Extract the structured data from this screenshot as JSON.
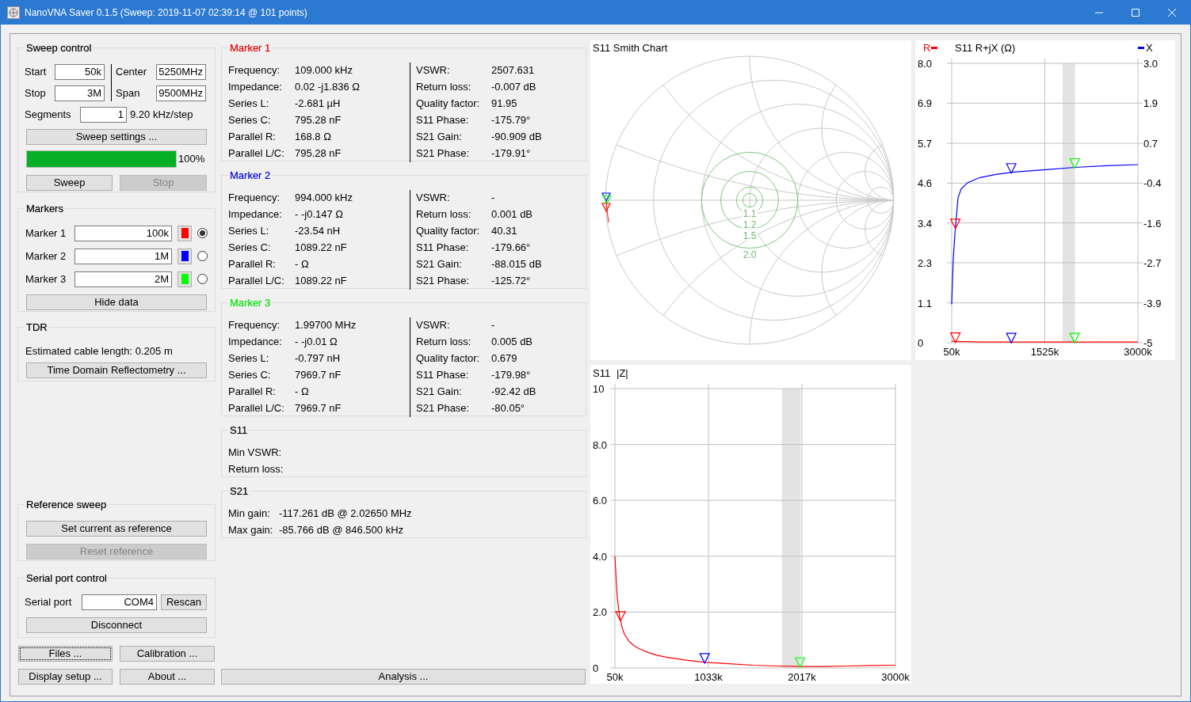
{
  "window": {
    "title": "NanoVNA Saver 0.1.5 (Sweep: 2019-11-07 02:39:14 @ 101 points)"
  },
  "sweep_control": {
    "title": "Sweep control",
    "start": {
      "label": "Start",
      "value": "50k"
    },
    "stop": {
      "label": "Stop",
      "value": "3M"
    },
    "center": {
      "label": "Center",
      "value": "5250MHz"
    },
    "span": {
      "label": "Span",
      "value": "9500MHz"
    },
    "segments": {
      "label": "Segments",
      "value": "1"
    },
    "step": "9.20 kHz/step",
    "settings_button": "Sweep settings ...",
    "progress": {
      "level": 1.0,
      "text": "100%"
    },
    "buttons": [
      {
        "label": "Sweep",
        "disabled": false
      },
      {
        "label": "Stop",
        "disabled": true
      }
    ]
  },
  "markers": {
    "title": "Markers",
    "items": [
      {
        "label": "Marker 1",
        "value": "100k",
        "color": "#ff0000",
        "selected": true
      },
      {
        "label": "Marker 2",
        "value": "1M",
        "color": "#0000ff",
        "selected": false
      },
      {
        "label": "Marker 3",
        "value": "2M",
        "color": "#00ff00",
        "selected": false
      }
    ],
    "hide_button": "Hide data"
  },
  "tdr": {
    "title": "TDR",
    "text": "Estimated cable length: 0.205 m",
    "button": "Time Domain Reflectometry ..."
  },
  "reference_sweep": {
    "title": "Reference sweep",
    "buttons": [
      {
        "label": "Set current as reference",
        "disabled": false
      },
      {
        "label": "Reset reference",
        "disabled": true
      }
    ]
  },
  "serial_port": {
    "title": "Serial port control",
    "label": "Serial port",
    "value": "COM4",
    "rescan_button": "Rescan",
    "disconnect_button": "Disconnect"
  },
  "bottom_buttons": [
    {
      "label": "Files ...",
      "focused": true
    },
    {
      "label": "Calibration ...",
      "focused": false
    },
    {
      "label": "Display setup ...",
      "focused": false
    },
    {
      "label": "About ...",
      "focused": false
    }
  ],
  "analysis_button": "Analysis ...",
  "marker_details": [
    {
      "title": "Marker 1",
      "color": "#ff0000",
      "left": [
        {
          "label": "Frequency:",
          "value": "109.000 kHz"
        },
        {
          "label": "Impedance:",
          "value": "0.02 -j1.836 Ω"
        },
        {
          "label": "Series L:",
          "value": "-2.681 µH"
        },
        {
          "label": "Series C:",
          "value": "795.28 nF"
        },
        {
          "label": "Parallel R:",
          "value": "168.8 Ω"
        },
        {
          "label": "Parallel L/C:",
          "value": "795.28 nF"
        }
      ],
      "right": [
        {
          "label": "VSWR:",
          "value": "2507.631"
        },
        {
          "label": "Return loss:",
          "value": "-0.007 dB"
        },
        {
          "label": "Quality factor:",
          "value": "91.95"
        },
        {
          "label": "S11 Phase:",
          "value": "-175.79°"
        },
        {
          "label": "S21 Gain:",
          "value": "-90.909 dB"
        },
        {
          "label": "S21 Phase:",
          "value": "-179.91°"
        }
      ]
    },
    {
      "title": "Marker 2",
      "color": "#0000ff",
      "left": [
        {
          "label": "Frequency:",
          "value": "994.000 kHz"
        },
        {
          "label": "Impedance:",
          "value": "- -j0.147 Ω"
        },
        {
          "label": "Series L:",
          "value": "-23.54 nH"
        },
        {
          "label": "Series C:",
          "value": "1089.22 nF"
        },
        {
          "label": "Parallel R:",
          "value": "- Ω"
        },
        {
          "label": "Parallel L/C:",
          "value": "1089.22 nF"
        }
      ],
      "right": [
        {
          "label": "VSWR:",
          "value": "-"
        },
        {
          "label": "Return loss:",
          "value": "0.001 dB"
        },
        {
          "label": "Quality factor:",
          "value": "40.31"
        },
        {
          "label": "S11 Phase:",
          "value": "-179.66°"
        },
        {
          "label": "S21 Gain:",
          "value": "-88.015 dB"
        },
        {
          "label": "S21 Phase:",
          "value": "-125.72°"
        }
      ]
    },
    {
      "title": "Marker 3",
      "color": "#00ff00",
      "left": [
        {
          "label": "Frequency:",
          "value": "1.99700 MHz"
        },
        {
          "label": "Impedance:",
          "value": "- -j0.01 Ω"
        },
        {
          "label": "Series L:",
          "value": "-0.797 nH"
        },
        {
          "label": "Series C:",
          "value": "7969.7 nF"
        },
        {
          "label": "Parallel R:",
          "value": "- Ω"
        },
        {
          "label": "Parallel L/C:",
          "value": "7969.7 nF"
        }
      ],
      "right": [
        {
          "label": "VSWR:",
          "value": "-"
        },
        {
          "label": "Return loss:",
          "value": "0.005 dB"
        },
        {
          "label": "Quality factor:",
          "value": "0.679"
        },
        {
          "label": "S11 Phase:",
          "value": "-179.98°"
        },
        {
          "label": "S21 Gain:",
          "value": "-92.42 dB"
        },
        {
          "label": "S21 Phase:",
          "value": "-80.05°"
        }
      ]
    }
  ],
  "s11": {
    "title": "S11",
    "rows": [
      {
        "label": "Min VSWR:"
      },
      {
        "label": "Return loss:"
      }
    ]
  },
  "s21": {
    "title": "S21",
    "rows": [
      {
        "label": "Min gain:",
        "value": "-117.261 dB @ 2.02650 MHz"
      },
      {
        "label": "Max gain:",
        "value": "-85.766 dB @ 846.500 kHz"
      }
    ]
  },
  "smith_chart": {
    "title": "S11 Smith Chart",
    "vswr_circles": [
      "1.1",
      "1.2",
      "1.5",
      "2.0"
    ]
  },
  "rjx_chart": {
    "chart_data": {
      "type": "line",
      "title": "S11 R+jX (Ω)",
      "x": [
        50,
        75,
        100,
        150,
        200,
        300,
        500,
        750,
        1000,
        1500,
        2000,
        2500,
        3000
      ],
      "xlim": [
        50,
        3000
      ],
      "xticks": [
        {
          "value": 50,
          "label": "50k"
        },
        {
          "value": 1525,
          "label": "1525k"
        },
        {
          "value": 3000,
          "label": "3000k"
        }
      ],
      "ylim": [
        0,
        8
      ],
      "yticks": [
        {
          "value": 0,
          "label": "0"
        },
        {
          "value": 1.14,
          "label": "1.1"
        },
        {
          "value": 2.29,
          "label": "2.3"
        },
        {
          "value": 3.43,
          "label": "3.4"
        },
        {
          "value": 4.57,
          "label": "4.6"
        },
        {
          "value": 5.71,
          "label": "5.7"
        },
        {
          "value": 6.86,
          "label": "6.9"
        },
        {
          "value": 8,
          "label": "8.0"
        }
      ],
      "y2lim": [
        -5,
        3
      ],
      "y2ticks": [
        {
          "value": -5,
          "label": "-5"
        },
        {
          "value": -3.86,
          "label": "-3.9"
        },
        {
          "value": -2.71,
          "label": "-2.7"
        },
        {
          "value": -1.57,
          "label": "-1.6"
        },
        {
          "value": -0.43,
          "label": "-0.4"
        },
        {
          "value": 0.71,
          "label": "0.7"
        },
        {
          "value": 1.86,
          "label": "1.9"
        },
        {
          "value": 3,
          "label": "3.0"
        }
      ],
      "series": [
        {
          "name": "R",
          "color": "#ff0000",
          "values": [
            0.05,
            0.04,
            0.03,
            0.03,
            0.03,
            0.03,
            0.02,
            0.02,
            0.02,
            0.02,
            0.02,
            0.02,
            0.02
          ]
        },
        {
          "name": "X",
          "color": "#0000ff",
          "axis": "y2",
          "values": [
            -3.9,
            -2.6,
            -1.9,
            -0.85,
            -0.6,
            -0.42,
            -0.27,
            -0.18,
            -0.12,
            -0.05,
            0.02,
            0.07,
            0.1
          ]
        }
      ],
      "grid": true
    }
  },
  "z_chart": {
    "chart_data": {
      "type": "line",
      "title": "S11",
      "x": [
        50,
        75,
        100,
        125,
        150,
        200,
        250,
        300,
        400,
        500,
        600,
        800,
        1000,
        1250,
        1500,
        1750,
        2000,
        2250,
        2500,
        2750,
        3000
      ],
      "xlim": [
        50,
        3000
      ],
      "xticks": [
        {
          "value": 50,
          "label": "50k"
        },
        {
          "value": 1033,
          "label": "1033k"
        },
        {
          "value": 2017,
          "label": "2017k"
        },
        {
          "value": 3000,
          "label": "3000k"
        }
      ],
      "ylim": [
        0,
        10
      ],
      "yticks": [
        {
          "value": 0,
          "label": "0"
        },
        {
          "value": 2,
          "label": "2.0"
        },
        {
          "value": 4,
          "label": "4.0"
        },
        {
          "value": 6,
          "label": "6.0"
        },
        {
          "value": 8,
          "label": "8.0"
        },
        {
          "value": 10,
          "label": "10"
        }
      ],
      "series": [
        {
          "name": "|Z|",
          "color": "#ff0000",
          "values": [
            4.0,
            2.5,
            1.85,
            1.45,
            1.2,
            0.95,
            0.8,
            0.7,
            0.55,
            0.45,
            0.38,
            0.28,
            0.2,
            0.15,
            0.1,
            0.07,
            0.05,
            0.05,
            0.07,
            0.09,
            0.1
          ]
        }
      ],
      "grid": true
    }
  }
}
